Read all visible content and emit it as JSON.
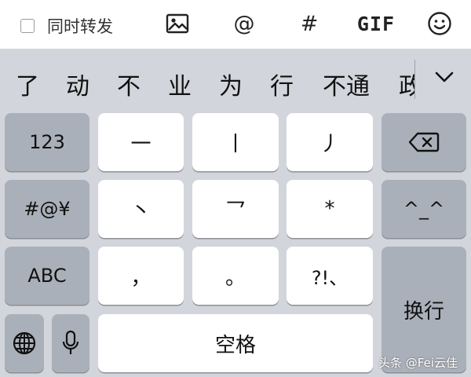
{
  "toolbar": {
    "forward_label": "同时转发",
    "mention_symbol": "@",
    "hashtag_symbol": "#",
    "gif_label": "GIF"
  },
  "candidates": [
    "了",
    "动",
    "不",
    "业",
    "为",
    "行",
    "不通",
    "政"
  ],
  "keys": {
    "num": "123",
    "symbols": "#@¥",
    "abc": "ABC",
    "stroke_heng": "一",
    "stroke_shu": "丨",
    "stroke_pie": "丿",
    "stroke_dian": "丶",
    "stroke_zhe": "乛",
    "wildcard": "*",
    "emoticon": "^_^",
    "comma": "，",
    "period": "。",
    "punct": "?!、",
    "space": "空格",
    "return": "换行"
  },
  "watermark": "头条 @Fei云佳"
}
